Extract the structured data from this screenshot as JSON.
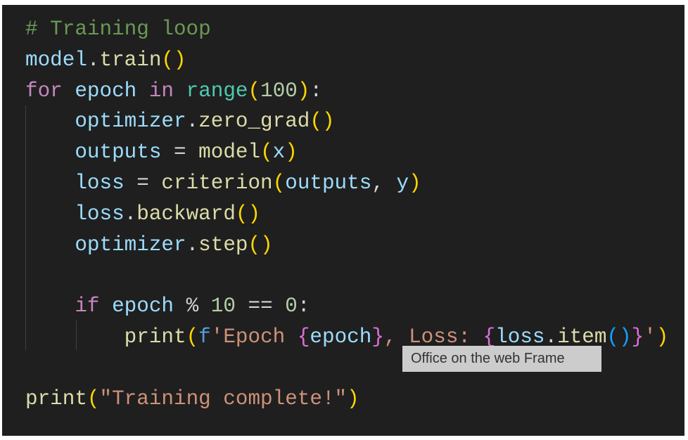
{
  "editor": {
    "theme_colors": {
      "background": "#1f1f1f",
      "comment": "#6a9955",
      "variable": "#9cdcfe",
      "function": "#dcdcaa",
      "keyword": "#c586c0",
      "builtin": "#4ec9b0",
      "number": "#b5cea8",
      "string": "#ce9178",
      "bracket_level1": "#ffd700",
      "bracket_level2": "#da70d6",
      "bracket_level3": "#179fff"
    },
    "lines": [
      {
        "tokens": [
          {
            "t": "# Training loop",
            "c": "comment"
          }
        ]
      },
      {
        "tokens": [
          {
            "t": "model",
            "c": "var"
          },
          {
            "t": ".",
            "c": "op"
          },
          {
            "t": "train",
            "c": "func"
          },
          {
            "t": "()",
            "c": "paren1"
          }
        ]
      },
      {
        "tokens": [
          {
            "t": "for",
            "c": "kw"
          },
          {
            "t": " ",
            "c": "op"
          },
          {
            "t": "epoch",
            "c": "var"
          },
          {
            "t": " ",
            "c": "op"
          },
          {
            "t": "in",
            "c": "kw"
          },
          {
            "t": " ",
            "c": "op"
          },
          {
            "t": "range",
            "c": "builtin"
          },
          {
            "t": "(",
            "c": "paren1"
          },
          {
            "t": "100",
            "c": "num"
          },
          {
            "t": ")",
            "c": "paren1"
          },
          {
            "t": ":",
            "c": "op"
          }
        ]
      },
      {
        "tokens": [
          {
            "t": "    ",
            "c": "op"
          },
          {
            "t": "optimizer",
            "c": "var"
          },
          {
            "t": ".",
            "c": "op"
          },
          {
            "t": "zero_grad",
            "c": "func"
          },
          {
            "t": "()",
            "c": "paren1"
          }
        ]
      },
      {
        "tokens": [
          {
            "t": "    ",
            "c": "op"
          },
          {
            "t": "outputs",
            "c": "var"
          },
          {
            "t": " = ",
            "c": "op"
          },
          {
            "t": "model",
            "c": "func"
          },
          {
            "t": "(",
            "c": "paren1"
          },
          {
            "t": "x",
            "c": "var"
          },
          {
            "t": ")",
            "c": "paren1"
          }
        ]
      },
      {
        "tokens": [
          {
            "t": "    ",
            "c": "op"
          },
          {
            "t": "loss",
            "c": "var"
          },
          {
            "t": " = ",
            "c": "op"
          },
          {
            "t": "criterion",
            "c": "func"
          },
          {
            "t": "(",
            "c": "paren1"
          },
          {
            "t": "outputs",
            "c": "var"
          },
          {
            "t": ", ",
            "c": "op"
          },
          {
            "t": "y",
            "c": "var"
          },
          {
            "t": ")",
            "c": "paren1"
          }
        ]
      },
      {
        "tokens": [
          {
            "t": "    ",
            "c": "op"
          },
          {
            "t": "loss",
            "c": "var"
          },
          {
            "t": ".",
            "c": "op"
          },
          {
            "t": "backward",
            "c": "func"
          },
          {
            "t": "()",
            "c": "paren1"
          }
        ]
      },
      {
        "tokens": [
          {
            "t": "    ",
            "c": "op"
          },
          {
            "t": "optimizer",
            "c": "var"
          },
          {
            "t": ".",
            "c": "op"
          },
          {
            "t": "step",
            "c": "func"
          },
          {
            "t": "()",
            "c": "paren1"
          }
        ]
      },
      {
        "tokens": []
      },
      {
        "tokens": [
          {
            "t": "    ",
            "c": "op"
          },
          {
            "t": "if",
            "c": "kw"
          },
          {
            "t": " ",
            "c": "op"
          },
          {
            "t": "epoch",
            "c": "var"
          },
          {
            "t": " % ",
            "c": "op"
          },
          {
            "t": "10",
            "c": "num"
          },
          {
            "t": " == ",
            "c": "op"
          },
          {
            "t": "0",
            "c": "num"
          },
          {
            "t": ":",
            "c": "op"
          }
        ]
      },
      {
        "tokens": [
          {
            "t": "        ",
            "c": "op"
          },
          {
            "t": "print",
            "c": "func"
          },
          {
            "t": "(",
            "c": "paren1"
          },
          {
            "t": "f",
            "c": "fprefix"
          },
          {
            "t": "'Epoch ",
            "c": "str"
          },
          {
            "t": "{",
            "c": "paren2"
          },
          {
            "t": "epoch",
            "c": "var"
          },
          {
            "t": "}",
            "c": "paren2"
          },
          {
            "t": ", Loss: ",
            "c": "str"
          },
          {
            "t": "{",
            "c": "paren2"
          },
          {
            "t": "loss",
            "c": "var"
          },
          {
            "t": ".",
            "c": "op"
          },
          {
            "t": "item",
            "c": "func"
          },
          {
            "t": "()",
            "c": "paren3"
          },
          {
            "t": "}",
            "c": "paren2"
          },
          {
            "t": "'",
            "c": "str"
          },
          {
            "t": ")",
            "c": "paren1"
          }
        ]
      },
      {
        "tokens": []
      },
      {
        "tokens": [
          {
            "t": "print",
            "c": "func"
          },
          {
            "t": "(",
            "c": "paren1"
          },
          {
            "t": "\"Training complete!\"",
            "c": "str"
          },
          {
            "t": ")",
            "c": "paren1"
          }
        ]
      }
    ]
  },
  "tooltip": {
    "text": "Office on the web Frame"
  }
}
